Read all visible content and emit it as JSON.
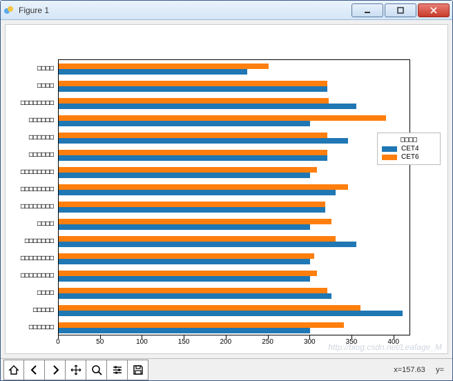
{
  "window": {
    "title": "Figure 1"
  },
  "toolbar": {
    "coord_x_label": "x=",
    "coord_x_value": "157.63",
    "coord_y_label": "y="
  },
  "watermark": "http://blog.csdn.net/Leafage_M",
  "legend": {
    "title": "□□□□",
    "items": [
      {
        "label": "CET4",
        "color": "#1f77b4"
      },
      {
        "label": "CET6",
        "color": "#ff7f0e"
      }
    ]
  },
  "chart_data": {
    "type": "bar",
    "orientation": "horizontal",
    "xlim": [
      0,
      420
    ],
    "xticks": [
      0,
      50,
      100,
      150,
      200,
      250,
      300,
      350,
      400
    ],
    "categories": [
      "□□□□□□",
      "□□□□□",
      "□□□□",
      "□□□□□□□□",
      "□□□□□□□□",
      "□□□□□□□",
      "□□□□",
      "□□□□□□□□",
      "□□□□□□□□",
      "□□□□□□□□",
      "□□□□□□",
      "□□□□□□",
      "□□□□□□",
      "□□□□□□□□",
      "□□□□",
      "□□□□"
    ],
    "series": [
      {
        "name": "CET4",
        "color": "#1f77b4",
        "values": [
          300,
          410,
          325,
          300,
          300,
          355,
          300,
          318,
          330,
          300,
          320,
          345,
          300,
          355,
          320,
          225
        ]
      },
      {
        "name": "CET6",
        "color": "#ff7f0e",
        "values": [
          340,
          360,
          320,
          308,
          305,
          330,
          325,
          318,
          345,
          308,
          320,
          320,
          390,
          322,
          320,
          250
        ]
      }
    ]
  }
}
